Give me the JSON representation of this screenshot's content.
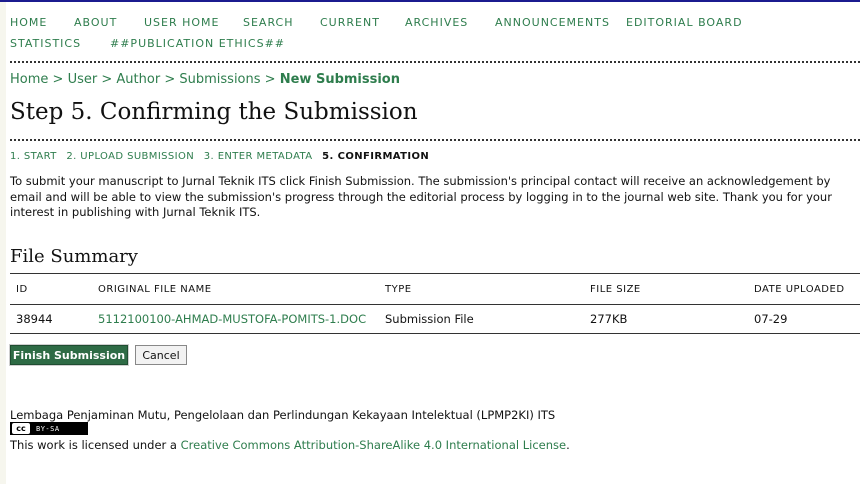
{
  "nav": {
    "items": [
      "HOME",
      "ABOUT",
      "USER HOME",
      "SEARCH",
      "CURRENT",
      "ARCHIVES",
      "ANNOUNCEMENTS",
      "EDITORIAL BOARD",
      "STATISTICS",
      "##PUBLICATION ETHICS##"
    ]
  },
  "breadcrumb": {
    "items": [
      "Home",
      "User",
      "Author",
      "Submissions"
    ],
    "separator": ">",
    "current": "New Submission"
  },
  "page_title": "Step 5. Confirming the Submission",
  "steps": [
    "1. START",
    "2. UPLOAD SUBMISSION",
    "3. ENTER METADATA",
    "5. CONFIRMATION"
  ],
  "intro": "To submit your manuscript to Jurnal Teknik ITS click Finish Submission. The submission's principal contact will receive an acknowledgement by email and will be able to view the submission's progress through the editorial process by logging in to the journal web site. Thank you for your interest in publishing with Jurnal Teknik ITS.",
  "file_summary": {
    "title": "File Summary",
    "columns": [
      "ID",
      "ORIGINAL FILE NAME",
      "TYPE",
      "FILE SIZE",
      "DATE UPLOADED"
    ],
    "rows": [
      {
        "id": "38944",
        "file_name": "5112100100-AHMAD-MUSTOFA-POMITS-1.DOC",
        "type": "Submission File",
        "size": "277KB",
        "date": "07-29"
      }
    ]
  },
  "buttons": {
    "finish": "Finish Submission",
    "cancel": "Cancel"
  },
  "footer": {
    "institution": "Lembaga Penjaminan Mutu, Pengelolaan dan Perlindungan Kekayaan Intelektual (LPMP2KI) ITS",
    "cc_badge_icon": "cc",
    "cc_badge_label": "BY-SA",
    "license_prefix": "This work is licensed under a",
    "license_link": "Creative Commons Attribution-ShareAlike 4.0 International License",
    "license_suffix": "."
  },
  "colors": {
    "link": "#2e7d4d",
    "primary_button": "#2e6b45",
    "top_border": "#1b1b8f"
  }
}
